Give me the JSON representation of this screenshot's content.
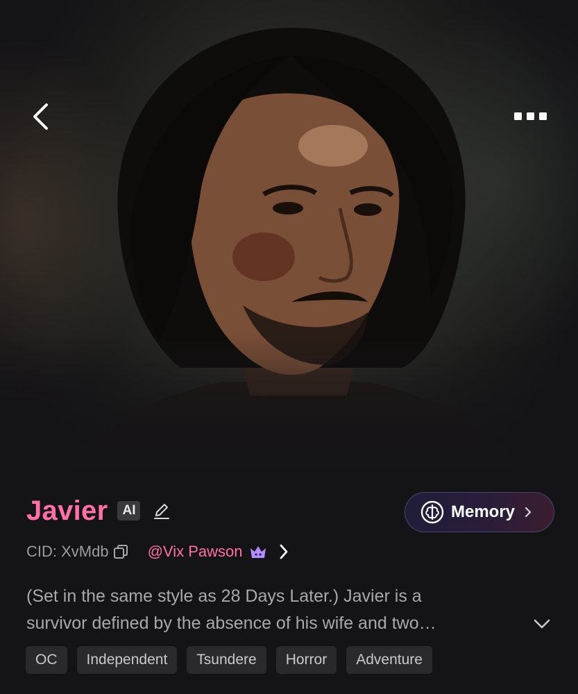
{
  "character": {
    "name": "Javier",
    "ai_badge": "AI",
    "cid": "CID: XvMdb",
    "creator": "@Vix Pawson",
    "description_line1": "(Set in the same style as 28 Days Later.) Javier is a",
    "description_line2": "survivor defined by the absence of his wife and two…"
  },
  "memory": {
    "label": "Memory"
  },
  "tags": [
    "OC",
    "Independent",
    "Tsundere",
    "Horror",
    "Adventure"
  ],
  "icons": {
    "back": "chevron-left-icon",
    "more": "more-icon",
    "edit": "pencil-icon",
    "memory": "brain-icon",
    "copy": "copy-icon",
    "crown": "crown-icon",
    "expand": "chevron-down-icon"
  },
  "colors": {
    "accent_pink": "#ff6fa8",
    "background": "#141316",
    "tag_bg": "#2a2a2d",
    "crown_purple": "#b48cff"
  }
}
